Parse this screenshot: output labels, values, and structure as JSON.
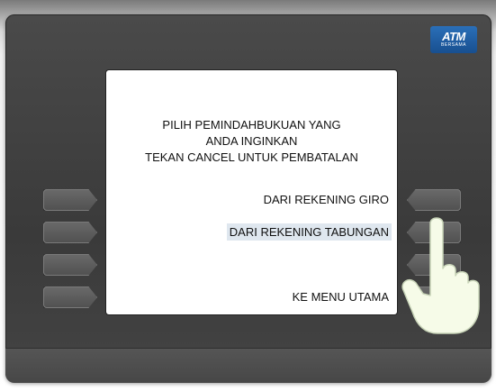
{
  "logo": {
    "main": "ATM",
    "sub": "BERSAMA"
  },
  "screen": {
    "prompt_lines": [
      "PILIH PEMINDAHBUKUAN YANG",
      "ANDA INGINKAN",
      "TEKAN CANCEL UNTUK PEMBATALAN"
    ],
    "options": [
      {
        "label": "DARI REKENING GIRO",
        "selected": false
      },
      {
        "label": "DARI REKENING TABUNGAN",
        "selected": true
      },
      {
        "label": "",
        "selected": false
      },
      {
        "label": "KE MENU UTAMA",
        "selected": false
      }
    ]
  },
  "icons": {
    "pointer": "pointing-hand-icon",
    "logo": "atm-bersama-logo"
  },
  "colors": {
    "body": "#3a3a3a",
    "screen": "#ffffff",
    "highlight": "#dfe7ef",
    "logo": "#1f5fa6"
  }
}
